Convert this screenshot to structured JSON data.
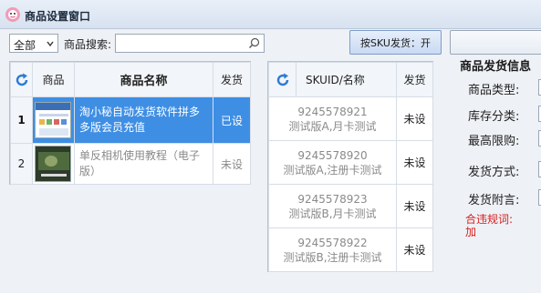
{
  "window": {
    "title": "商品设置窗口"
  },
  "toolbar": {
    "filter_selected": "全部",
    "search_label": "商品搜索:",
    "search_value": "",
    "sku_button": "按SKU发货：开"
  },
  "product_table": {
    "headers": {
      "image": "商品",
      "name": "商品名称",
      "status": "发货"
    },
    "rows": [
      {
        "num": "1",
        "name": "淘小秘自动发货软件拼多多版会员充值",
        "status": "已设",
        "selected": true
      },
      {
        "num": "2",
        "name": "单反相机使用教程（电子版）",
        "status": "未设",
        "selected": false
      }
    ]
  },
  "sku_table": {
    "headers": {
      "name": "SKUID/名称",
      "status": "发货"
    },
    "rows": [
      {
        "id": "9245578921",
        "name": "测试版A,月卡测试",
        "status": "未设"
      },
      {
        "id": "9245578920",
        "name": "测试版A,注册卡测试",
        "status": "未设"
      },
      {
        "id": "9245578923",
        "name": "测试版B,月卡测试",
        "status": "未设"
      },
      {
        "id": "9245578922",
        "name": "测试版B,注册卡测试",
        "status": "未设"
      }
    ]
  },
  "info_panel": {
    "title": "商品发货信息",
    "labels": {
      "type": "商品类型:",
      "stock": "库存分类:",
      "limit": "最高限购:",
      "method": "发货方式:",
      "note": "发货附言:"
    },
    "warning": "合违规词:加"
  },
  "colors": {
    "selected_row": "#3e8ee4",
    "warning": "#d81e1e",
    "button_border": "#7f9dc7"
  },
  "icons": {
    "refresh": "refresh-icon",
    "search": "search-icon",
    "app": "app-logo-icon"
  }
}
